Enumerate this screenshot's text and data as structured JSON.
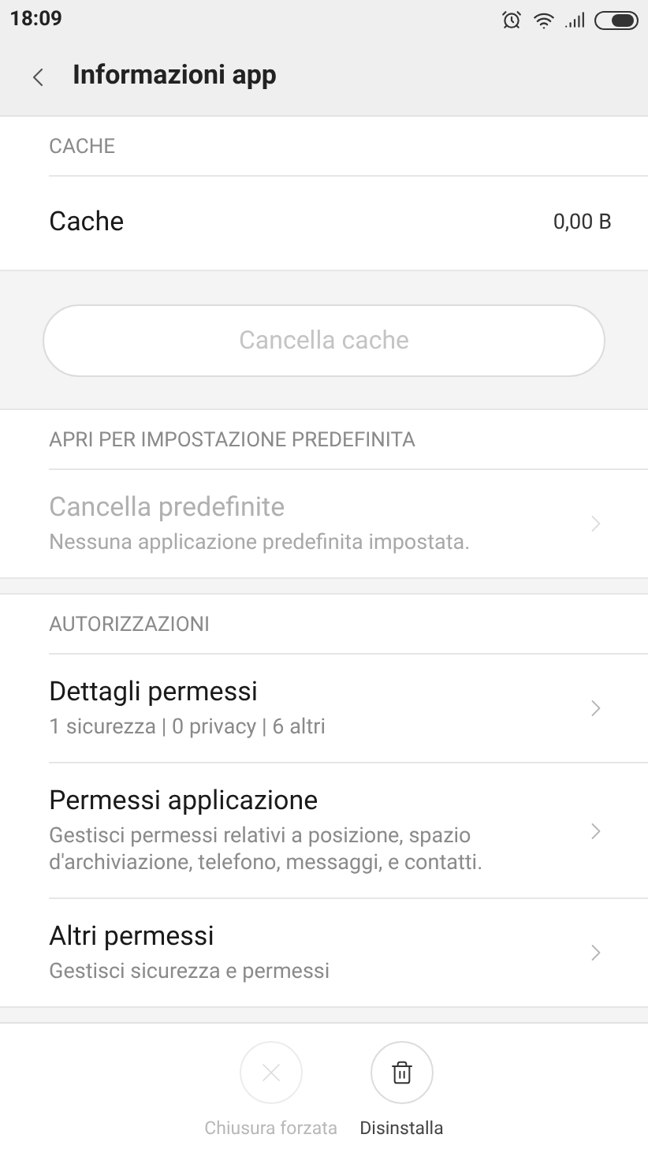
{
  "status_bar": {
    "time": "18:09"
  },
  "header": {
    "title": "Informazioni app"
  },
  "cache_section": {
    "heading": "CACHE",
    "label": "Cache",
    "value": "0,00 B",
    "button": {
      "label": "Cancella cache",
      "disabled": true
    }
  },
  "defaults_section": {
    "heading": "APRI PER IMPOSTAZIONE PREDEFINITA",
    "items": [
      {
        "title": "Cancella predefinite",
        "subtitle": "Nessuna applicazione predefinita impostata.",
        "disabled": true
      }
    ]
  },
  "permissions_section": {
    "heading": "AUTORIZZAZIONI",
    "items": [
      {
        "title": "Dettagli permessi",
        "subtitle": "1 sicurezza | 0 privacy | 6 altri",
        "disabled": false
      },
      {
        "title": "Permessi applicazione",
        "subtitle": "Gestisci permessi relativi a posizione, spazio d'archiviazione, telefono, messaggi, e contatti.",
        "disabled": false
      },
      {
        "title": "Altri permessi",
        "subtitle": "Gestisci sicurezza e permessi",
        "disabled": false
      }
    ]
  },
  "actions": [
    {
      "kind": "force-stop",
      "label": "Chiusura forzata",
      "disabled": true
    },
    {
      "kind": "uninstall",
      "label": "Disinstalla",
      "disabled": false
    }
  ]
}
